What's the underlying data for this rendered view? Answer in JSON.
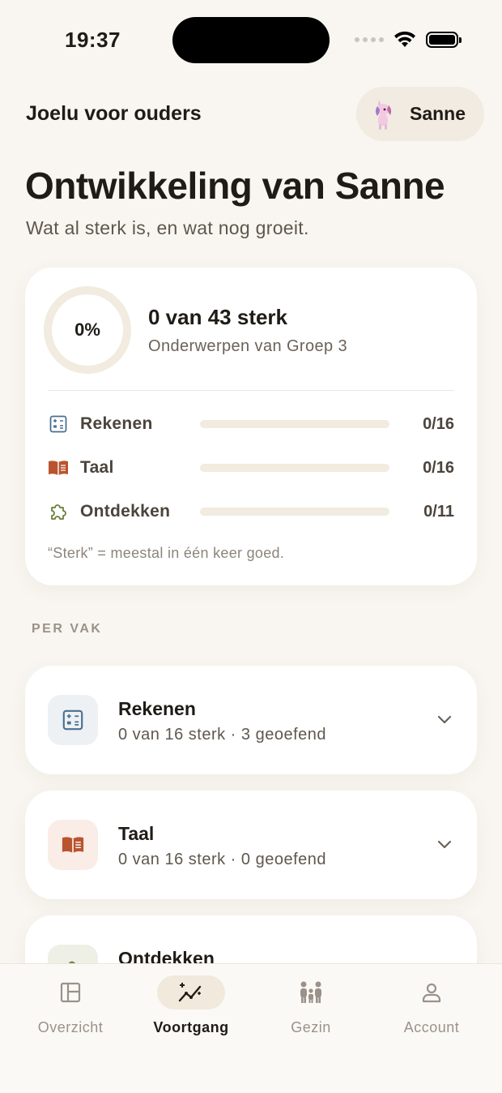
{
  "status_bar": {
    "time": "19:37"
  },
  "header": {
    "app_name": "Joelu voor ouders",
    "profile_name": "Sanne",
    "title": "Ontwikkeling van Sanne",
    "subtitle": "Wat al sterk is, en wat nog groeit."
  },
  "summary": {
    "percent_label": "0%",
    "progress_fraction": 0,
    "title": "0 van 43 sterk",
    "subtitle": "Onderwerpen van Groep 3",
    "subjects": [
      {
        "label": "Rekenen",
        "count": "0/16",
        "fraction": 0,
        "icon": "calculator-icon",
        "color": "#4a6f8f"
      },
      {
        "label": "Taal",
        "count": "0/16",
        "fraction": 0,
        "icon": "book-icon",
        "color": "#b9542f"
      },
      {
        "label": "Ontdekken",
        "count": "0/11",
        "fraction": 0,
        "icon": "puzzle-icon",
        "color": "#6a7f3a"
      }
    ],
    "footnote": "“Sterk” = meestal in één keer goed."
  },
  "per_vak": {
    "section_label": "PER VAK",
    "cards": [
      {
        "name": "Rekenen",
        "meta": "0 van 16 sterk · 3 geoefend",
        "icon": "calculator-icon",
        "tile_color": "#edf1f4"
      },
      {
        "name": "Taal",
        "meta": "0 van 16 sterk · 0 geoefend",
        "icon": "book-icon",
        "tile_color": "#faece7"
      },
      {
        "name": "Ontdekken",
        "meta": "",
        "icon": "puzzle-icon",
        "tile_color": "#eef0e6"
      }
    ]
  },
  "tabbar": {
    "tabs": [
      {
        "label": "Overzicht",
        "icon": "layout-icon",
        "active": false
      },
      {
        "label": "Voortgang",
        "icon": "trend-sparkle-icon",
        "active": true
      },
      {
        "label": "Gezin",
        "icon": "family-icon",
        "active": false
      },
      {
        "label": "Account",
        "icon": "person-icon",
        "active": false
      }
    ]
  }
}
